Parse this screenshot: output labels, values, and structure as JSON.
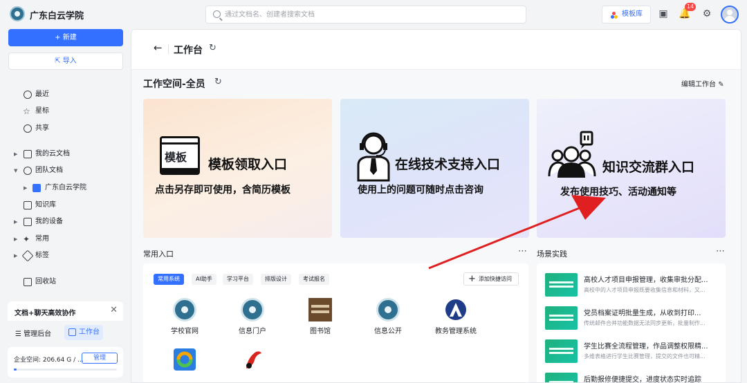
{
  "app": {
    "title": "广东白云学院"
  },
  "search": {
    "placeholder": "通过文档名、创建者搜索文档"
  },
  "topbar": {
    "template_label": "模板库",
    "notification_count": "14"
  },
  "sidebar": {
    "new_label": "新建",
    "import_label": "导入",
    "items": [
      {
        "label": "最近",
        "icon": "clock-icon"
      },
      {
        "label": "星标",
        "icon": "star-icon"
      },
      {
        "label": "共享",
        "icon": "share-icon"
      },
      {
        "label": "我的云文档",
        "icon": "folder-icon"
      },
      {
        "label": "团队文档",
        "icon": "team-icon"
      },
      {
        "label": "广东白云学院",
        "icon": "team-space-icon"
      },
      {
        "label": "知识库",
        "icon": "knowledge-icon"
      },
      {
        "label": "我的设备",
        "icon": "device-icon"
      },
      {
        "label": "常用",
        "icon": "pin-icon"
      },
      {
        "label": "标签",
        "icon": "tag-icon"
      },
      {
        "label": "回收站",
        "icon": "trash-icon"
      }
    ],
    "promo_title": "文档+聊天高效协作",
    "management_label": "管理后台",
    "workbench_label": "工作台",
    "storage_text": "企业空间: 206.64 G / ...",
    "storage_button": "管理",
    "storage_used_fraction": 0.03
  },
  "main": {
    "page_title": "工作台",
    "workspace_title": "工作空间-全员",
    "edit_label": "编辑工作台",
    "banners": [
      {
        "title": "模板领取入口",
        "subtitle": "点击另存即可使用，含简历模板",
        "icon_text": "模板"
      },
      {
        "title": "在线技术支持入口",
        "subtitle": "使用上的问题可随时点击咨询"
      },
      {
        "title": "知识交流群入口",
        "subtitle": "发布使用技巧、活动通知等"
      }
    ],
    "common_entry": {
      "title": "常用入口",
      "tabs": [
        "常用系统",
        "AI助手",
        "学习平台",
        "排版设计",
        "考试报名"
      ],
      "add_label": "添加快捷访问",
      "apps": [
        {
          "label": "学校官网"
        },
        {
          "label": "信息门户"
        },
        {
          "label": "图书馆"
        },
        {
          "label": "信息公开"
        },
        {
          "label": "教务管理系统"
        }
      ]
    },
    "scenes": {
      "title": "场景实践",
      "items": [
        {
          "title": "高校人才项目申报管理，收集审批分配...",
          "desc": "高校中的人才项目申报既要收集信息和材料，又..."
        },
        {
          "title": "党员档案证明批量生成，从收到打印...",
          "desc": "传统邮件合并功能数据无法同步更新，批量制作..."
        },
        {
          "title": "学生比赛全流程管理，作品调整权限精...",
          "desc": "多维表格进行学生比赛管理，提交的文件也可精..."
        },
        {
          "title": "后勤报修便捷提交，进度状态实时追踪",
          "desc": ""
        }
      ]
    }
  }
}
